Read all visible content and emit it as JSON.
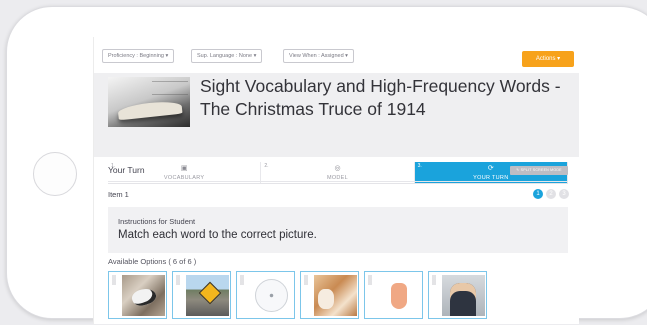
{
  "filters": {
    "proficiency": "Proficiency : Beginning ▾",
    "sup_language": "Sup. Language : None ▾",
    "view_when": "View When : Assigned ▾",
    "actions": "Actions ▾"
  },
  "lesson": {
    "title": "Sight Vocabulary and High-Frequency Words - The Christmas Truce of 1914"
  },
  "steps": [
    {
      "num": "1.",
      "icon": "camera-icon",
      "label": "VOCABULARY",
      "glyph": "▣"
    },
    {
      "num": "2.",
      "icon": "model-icon",
      "label": "MODEL",
      "glyph": "◎"
    },
    {
      "num": "3.",
      "icon": "refresh-icon",
      "label": "YOUR TURN",
      "glyph": "⟳"
    }
  ],
  "section": {
    "title": "Your Turn",
    "split_button": "✎ SPLIT SCREEN MODE"
  },
  "item": {
    "title": "Item 1",
    "pager": [
      "1",
      "2",
      "3"
    ]
  },
  "instructions": {
    "heading": "Instructions for Student",
    "body": "Match each word to the correct picture."
  },
  "options": {
    "title": "Available Options ( 6 of 6 )"
  },
  "colors": {
    "accent": "#1aa3dc",
    "actions": "#f7a21b"
  }
}
